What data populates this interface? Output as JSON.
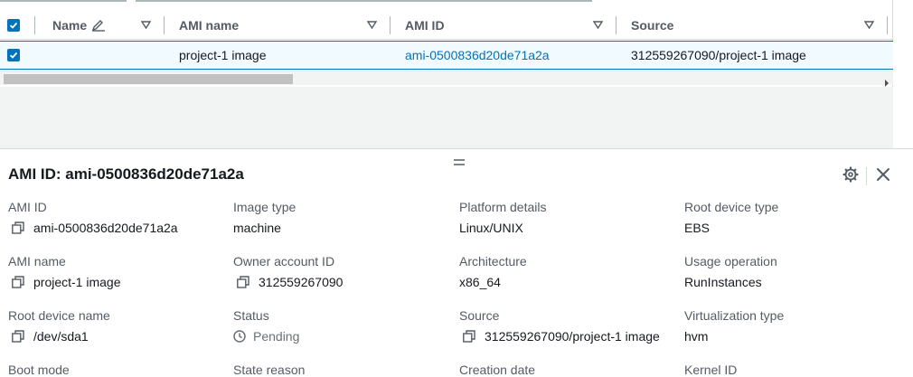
{
  "table": {
    "columns": [
      "Name",
      "AMI name",
      "AMI ID",
      "Source"
    ],
    "row": {
      "name": "",
      "ami_name": "project-1 image",
      "ami_id": "ami-0500836d20de71a2a",
      "source": "312559267090/project-1 image",
      "selected": true
    }
  },
  "details": {
    "title": "AMI ID: ami-0500836d20de71a2a",
    "fields": {
      "ami_id": {
        "label": "AMI ID",
        "value": "ami-0500836d20de71a2a"
      },
      "image_type": {
        "label": "Image type",
        "value": "machine"
      },
      "platform_details": {
        "label": "Platform details",
        "value": "Linux/UNIX"
      },
      "root_device_type": {
        "label": "Root device type",
        "value": "EBS"
      },
      "ami_name": {
        "label": "AMI name",
        "value": "project-1 image"
      },
      "owner_account_id": {
        "label": "Owner account ID",
        "value": "312559267090"
      },
      "architecture": {
        "label": "Architecture",
        "value": "x86_64"
      },
      "usage_operation": {
        "label": "Usage operation",
        "value": "RunInstances"
      },
      "root_device_name": {
        "label": "Root device name",
        "value": "/dev/sda1"
      },
      "status": {
        "label": "Status",
        "value": "Pending"
      },
      "source": {
        "label": "Source",
        "value": "312559267090/project-1 image"
      },
      "virtualization_type": {
        "label": "Virtualization type",
        "value": "hvm"
      },
      "boot_mode": {
        "label": "Boot mode",
        "value": ""
      },
      "state_reason": {
        "label": "State reason",
        "value": ""
      },
      "creation_date": {
        "label": "Creation date",
        "value": ""
      },
      "kernel_id": {
        "label": "Kernel ID",
        "value": ""
      }
    }
  },
  "icons": {
    "copy": "copy-icon",
    "status": "clock-icon",
    "settings": "gear-icon",
    "close": "close-icon",
    "edit": "pencil-icon",
    "sort": "sort-triangle-icon"
  },
  "colors": {
    "accent": "#0073bb",
    "selected_row_bg": "#f1faff",
    "panel_gray": "#f2f3f3"
  }
}
